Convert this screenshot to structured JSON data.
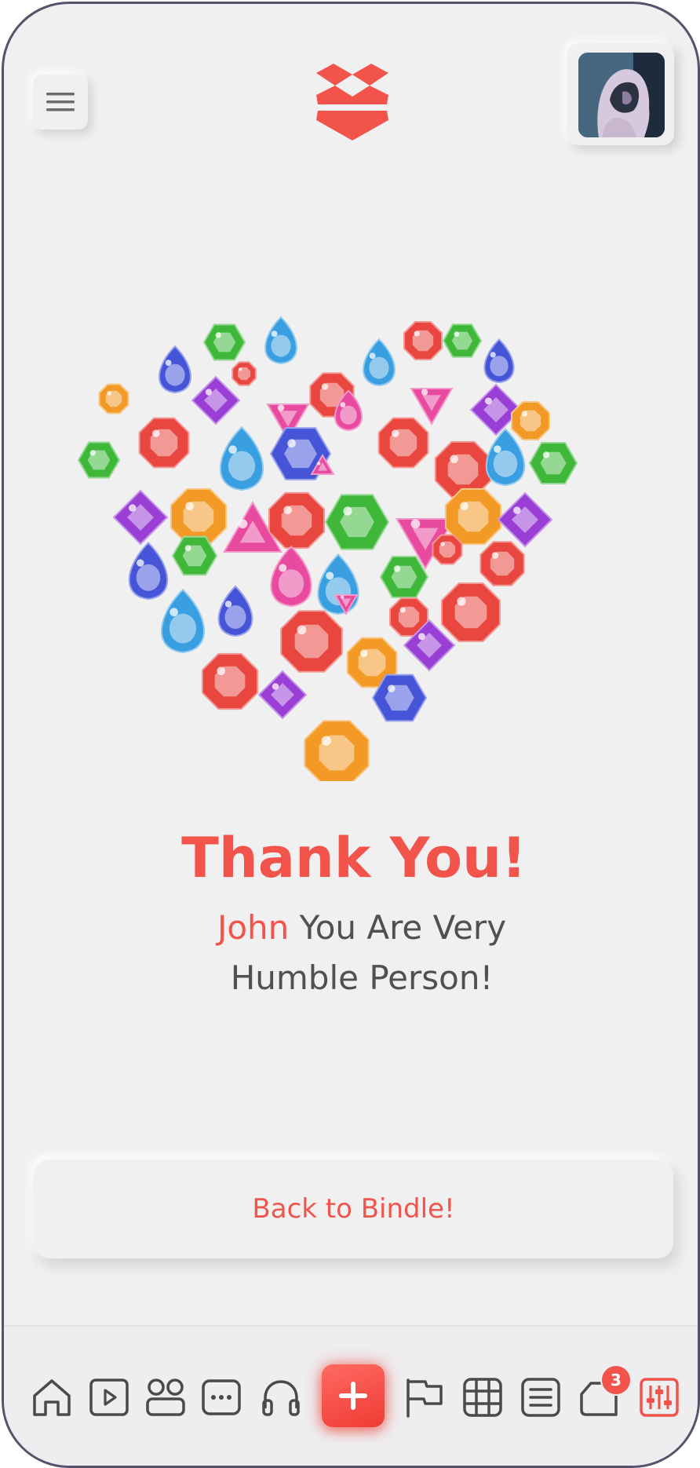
{
  "header": {
    "menu_icon": "hamburger-menu-icon",
    "logo_icon": "dropbox-logo-icon",
    "avatar": "user-avatar"
  },
  "illustration": {
    "name": "gem-heart",
    "gem_colors": [
      "#e8463f",
      "#f29a25",
      "#3fb83a",
      "#3a9fe0",
      "#4655d8",
      "#9a3fd6",
      "#e84aa0"
    ]
  },
  "main": {
    "title": "Thank You!",
    "message_name": "John",
    "message_line1_rest": " You Are Very",
    "message_line2": "Humble Person!"
  },
  "back_button": {
    "label": "Back to Bindle!"
  },
  "tabbar": {
    "items": [
      {
        "icon": "home-icon"
      },
      {
        "icon": "play-icon"
      },
      {
        "icon": "apps-icon"
      },
      {
        "icon": "chat-icon"
      },
      {
        "icon": "headphones-icon"
      },
      {
        "icon": "add-icon"
      },
      {
        "icon": "flag-icon"
      },
      {
        "icon": "grid-icon"
      },
      {
        "icon": "notes-icon"
      },
      {
        "icon": "notification-icon"
      },
      {
        "icon": "settings-sliders-icon"
      }
    ],
    "badge_count": "3",
    "accent": "#f2544c",
    "icon_color": "#4a4a4a"
  }
}
